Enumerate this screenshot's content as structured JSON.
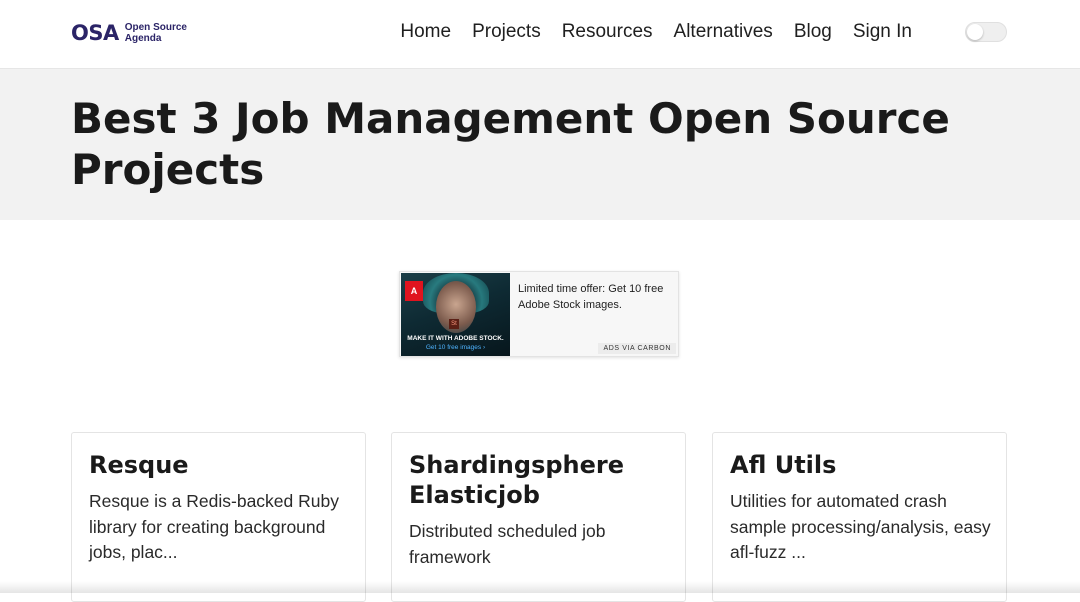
{
  "header": {
    "logo_mark": "OSA",
    "logo_line1": "Open Source",
    "logo_line2": "Agenda",
    "nav": [
      "Home",
      "Projects",
      "Resources",
      "Alternatives",
      "Blog",
      "Sign In"
    ],
    "theme_toggle_icon": "toggle-switch-icon"
  },
  "hero": {
    "title_line1": "Best 3 Job Management Open Source",
    "title_line2": "Projects"
  },
  "ad": {
    "logo_letter": "A",
    "st_badge": "St",
    "image_caption": "MAKE IT WITH ADOBE STOCK.",
    "image_cta": "Get 10 free images ›",
    "text": "Limited time offer: Get 10 free Adobe Stock images.",
    "via": "ADS VIA CARBON"
  },
  "projects": [
    {
      "title": "Resque",
      "description": "Resque is a Redis-backed Ruby library for creating background jobs, plac..."
    },
    {
      "title": "Shardingsphere Elasticjob",
      "description": "Distributed scheduled job framework"
    },
    {
      "title": "Afl Utils",
      "description": "Utilities for automated crash sample processing/analysis, easy afl-fuzz ..."
    }
  ],
  "colors": {
    "brand": "#2b2467",
    "hero_bg": "#f2f2f2",
    "ad_accent": "#e0141f"
  }
}
